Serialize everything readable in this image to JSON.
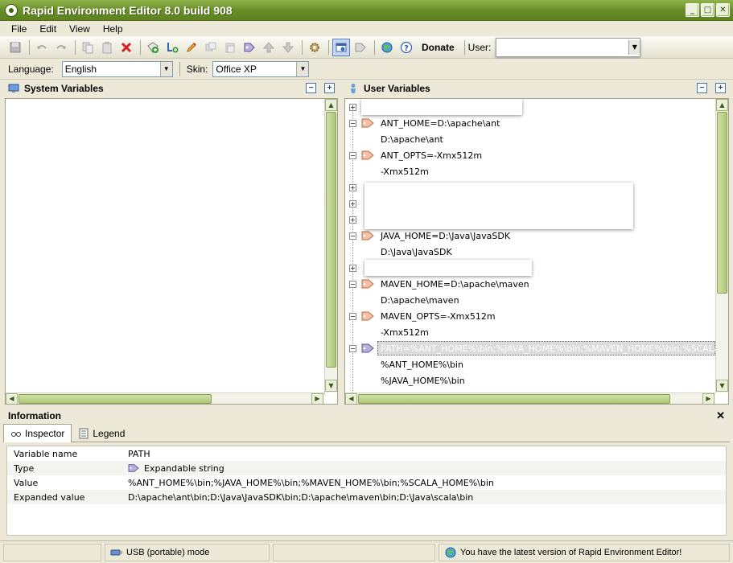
{
  "window": {
    "title": "Rapid Environment Editor 8.0 build 908"
  },
  "menu": [
    "File",
    "Edit",
    "View",
    "Help"
  ],
  "toolbar": {
    "donate_label": "Donate",
    "user_label": "User:",
    "user_value": ""
  },
  "toolbar2": {
    "language_label": "Language:",
    "language_value": "English",
    "skin_label": "Skin:",
    "skin_value": "Office XP"
  },
  "system_panel": {
    "title": "System Variables"
  },
  "user_panel": {
    "title": "User Variables",
    "rows": [
      {
        "kind": "hidden"
      },
      {
        "kind": "var",
        "text": "ANT_HOME=D:\\apache\\ant"
      },
      {
        "kind": "child",
        "text": "D:\\apache\\ant"
      },
      {
        "kind": "var",
        "text": "ANT_OPTS=-Xmx512m"
      },
      {
        "kind": "child",
        "text": "-Xmx512m"
      },
      {
        "kind": "hidden"
      },
      {
        "kind": "hidden"
      },
      {
        "kind": "hidden"
      },
      {
        "kind": "var",
        "text": "JAVA_HOME=D:\\Java\\JavaSDK"
      },
      {
        "kind": "child",
        "text": "D:\\Java\\JavaSDK"
      },
      {
        "kind": "hidden"
      },
      {
        "kind": "var",
        "text": "MAVEN_HOME=D:\\apache\\maven"
      },
      {
        "kind": "child",
        "text": "D:\\apache\\maven"
      },
      {
        "kind": "var",
        "text": "MAVEN_OPTS=-Xmx512m"
      },
      {
        "kind": "child",
        "text": "-Xmx512m"
      },
      {
        "kind": "var",
        "text": "PATH=%ANT_HOME%\\bin;%JAVA_HOME%\\bin;%MAVEN_HOME%\\bin;%SCALA_HOME%\\bin",
        "selected": true
      },
      {
        "kind": "child",
        "text": "%ANT_HOME%\\bin"
      },
      {
        "kind": "child",
        "text": "%JAVA_HOME%\\bin"
      }
    ]
  },
  "info": {
    "title": "Information",
    "tabs": [
      "Inspector",
      "Legend"
    ],
    "rows": [
      {
        "key": "Variable name",
        "value": "PATH"
      },
      {
        "key": "Type",
        "value": "Expandable string"
      },
      {
        "key": "Value",
        "value": "%ANT_HOME%\\bin;%JAVA_HOME%\\bin;%MAVEN_HOME%\\bin;%SCALA_HOME%\\bin"
      },
      {
        "key": "Expanded value",
        "value": "D:\\apache\\ant\\bin;D:\\Java\\JavaSDK\\bin;D:\\apache\\maven\\bin;D:\\Java\\scala\\bin"
      }
    ]
  },
  "status": {
    "mode": "USB (portable) mode",
    "update": "You have the latest version of Rapid Environment Editor!"
  }
}
